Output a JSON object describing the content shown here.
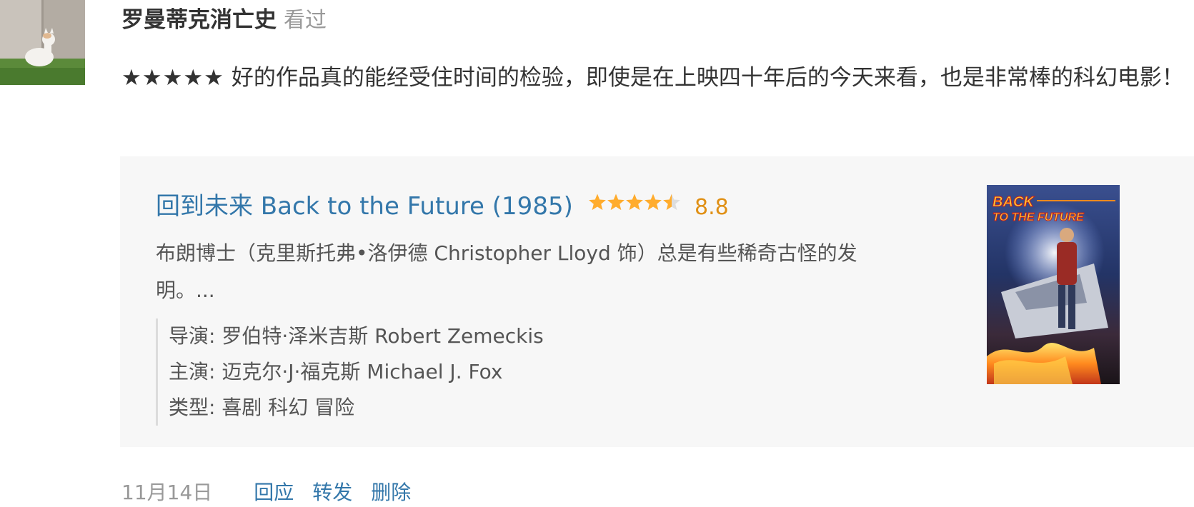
{
  "user": {
    "name": "罗曼蒂克消亡史",
    "status": "看过"
  },
  "comment": {
    "stars": "★★★★★",
    "text": " 好的作品真的能经受住时间的检验，即使是在上映四十年后的今天来看，也是非常棒的科幻电影！"
  },
  "movie": {
    "title": "回到未来 Back to the Future (1985)",
    "rating_stars": 4.5,
    "rating": "8.8",
    "summary": "布朗博士（克里斯托弗•洛伊德 Christopher Lloyd 饰）总是有些稀奇古怪的发明。...",
    "director": "导演: 罗伯特·泽米吉斯 Robert Zemeckis",
    "cast": "主演: 迈克尔·J·福克斯 Michael J. Fox",
    "genre": "类型: 喜剧 科幻 冒险",
    "poster_title": "BACK TO THE FUTURE"
  },
  "footer": {
    "date": "11月14日",
    "reply": "回应",
    "share": "转发",
    "delete": "删除"
  },
  "colors": {
    "link": "#3377aa",
    "rating": "#e09015",
    "star_fill": "#ffac2d",
    "star_empty": "#dddddd",
    "muted": "#999999",
    "card_bg": "#f7f7f7"
  }
}
